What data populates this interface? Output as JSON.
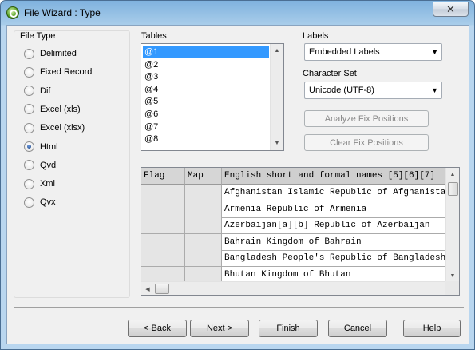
{
  "window": {
    "title": "File Wizard : Type",
    "close_label": "✕"
  },
  "file_type": {
    "label": "File Type",
    "options": [
      {
        "label": "Delimited",
        "checked": false
      },
      {
        "label": "Fixed Record",
        "checked": false
      },
      {
        "label": "Dif",
        "checked": false
      },
      {
        "label": "Excel (xls)",
        "checked": false
      },
      {
        "label": "Excel (xlsx)",
        "checked": false
      },
      {
        "label": "Html",
        "checked": true
      },
      {
        "label": "Qvd",
        "checked": false
      },
      {
        "label": "Xml",
        "checked": false
      },
      {
        "label": "Qvx",
        "checked": false
      }
    ]
  },
  "tables": {
    "label": "Tables",
    "items": [
      "@1",
      "@2",
      "@3",
      "@4",
      "@5",
      "@6",
      "@7",
      "@8"
    ],
    "selected": "@1"
  },
  "labels": {
    "label": "Labels",
    "value": "Embedded Labels"
  },
  "charset": {
    "label": "Character Set",
    "value": "Unicode (UTF-8)"
  },
  "buttons": {
    "analyze": "Analyze Fix Positions",
    "clear": "Clear Fix Positions",
    "back": "< Back",
    "next": "Next >",
    "finish": "Finish",
    "cancel": "Cancel",
    "help": "Help"
  },
  "grid": {
    "headers": [
      "Flag",
      "Map",
      "English short and formal names [5][6][7]"
    ],
    "rows": [
      "Afghanistan  Islamic Republic of Afghanistan",
      "Armenia  Republic of Armenia",
      "Azerbaijan[a][b]  Republic of Azerbaijan",
      "Bahrain  Kingdom of Bahrain",
      "Bangladesh  People's Republic of Bangladesh",
      "Bhutan  Kingdom of Bhutan"
    ]
  }
}
